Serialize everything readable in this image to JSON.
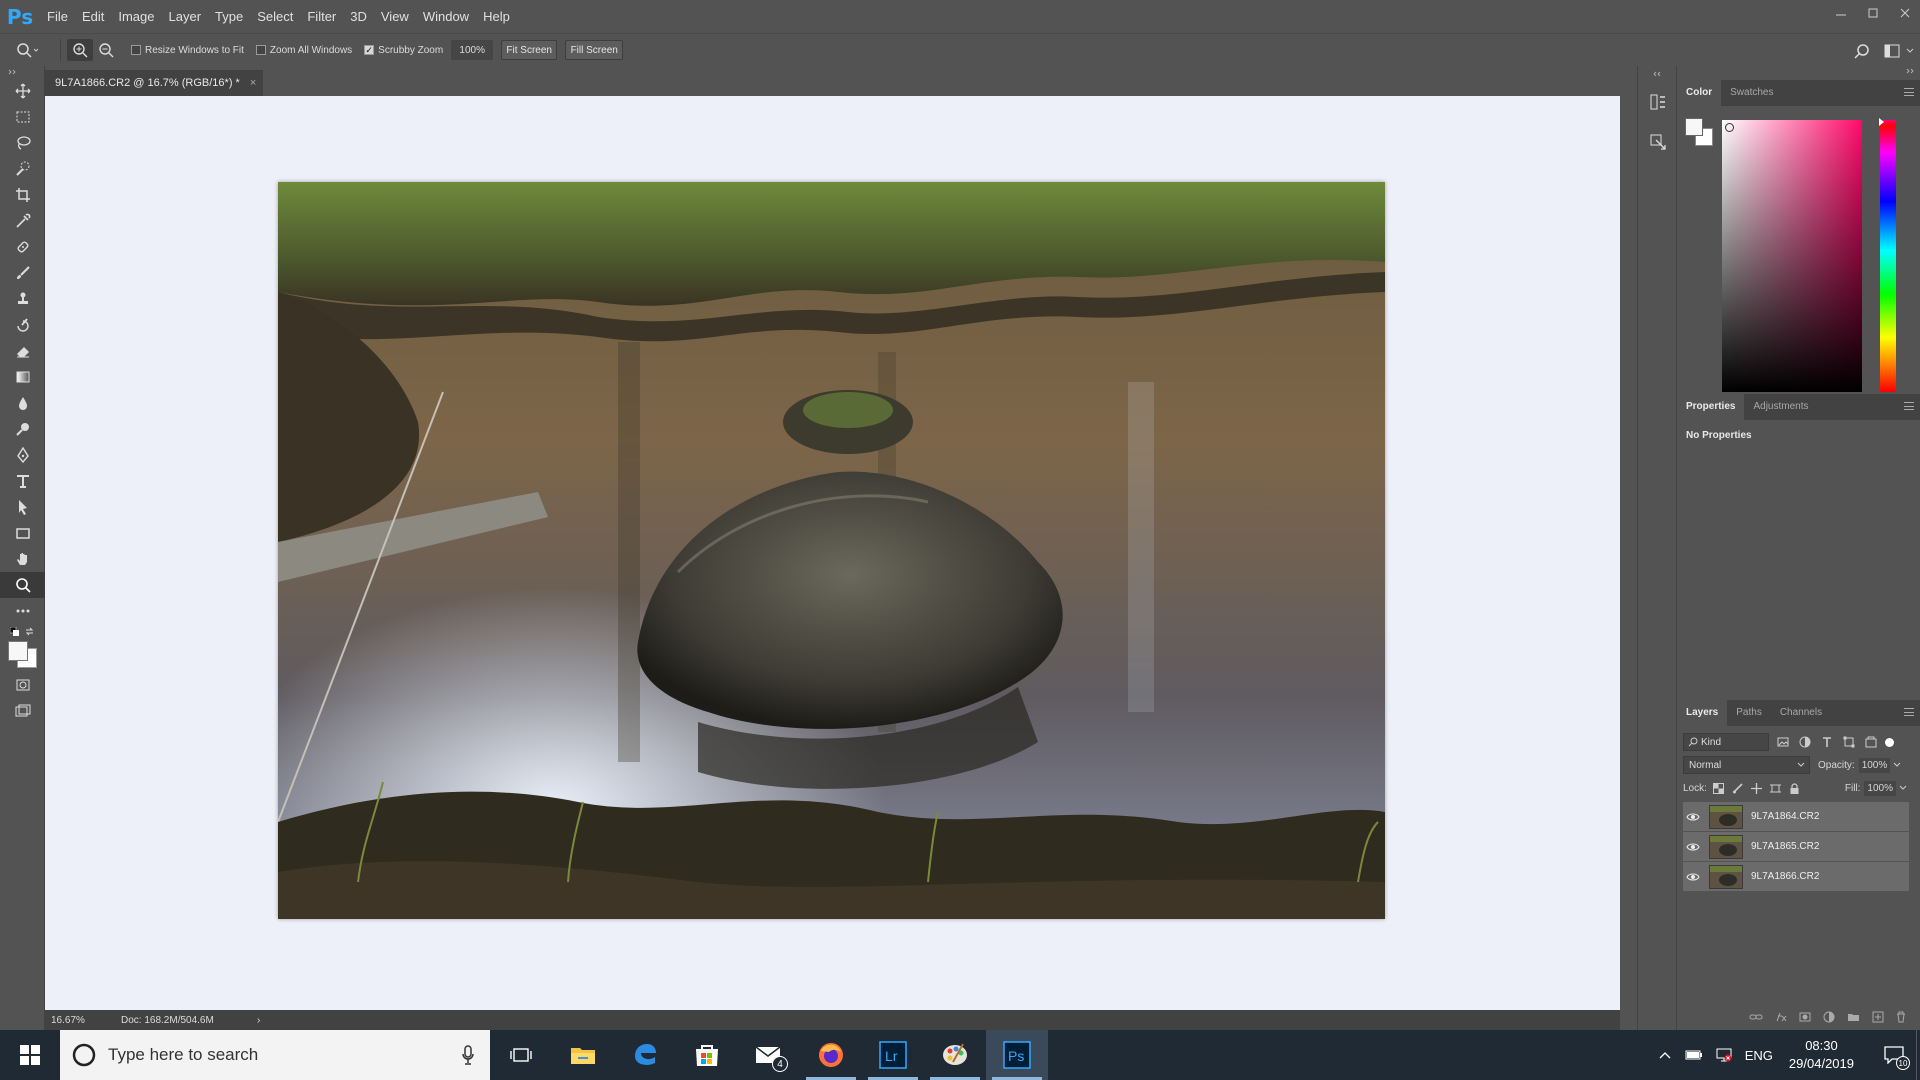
{
  "app": {
    "logo": "Ps"
  },
  "menu": [
    "File",
    "Edit",
    "Image",
    "Layer",
    "Type",
    "Select",
    "Filter",
    "3D",
    "View",
    "Window",
    "Help"
  ],
  "options": {
    "resize_windows": "Resize Windows to Fit",
    "zoom_all": "Zoom All Windows",
    "scrubby_zoom": "Scrubby Zoom",
    "zoom_value": "100%",
    "fit_screen": "Fit Screen",
    "fill_screen": "Fill Screen"
  },
  "document": {
    "tab_title": "9L7A1866.CR2 @ 16.7% (RGB/16*) *",
    "close": "×"
  },
  "status": {
    "zoom": "16.67%",
    "doc": "Doc: 168.2M/504.6M",
    "arrow": "›"
  },
  "color_panel": {
    "tabs": [
      "Color",
      "Swatches"
    ]
  },
  "properties_panel": {
    "tabs": [
      "Properties",
      "Adjustments"
    ],
    "message": "No Properties"
  },
  "layers_panel": {
    "tabs": [
      "Layers",
      "Paths",
      "Channels"
    ],
    "filter": "Kind",
    "blend_mode": "Normal",
    "opacity_label": "Opacity:",
    "opacity": "100%",
    "lock_label": "Lock:",
    "fill_label": "Fill:",
    "fill": "100%",
    "layers": [
      {
        "name": "9L7A1864.CR2"
      },
      {
        "name": "9L7A1865.CR2"
      },
      {
        "name": "9L7A1866.CR2"
      }
    ]
  },
  "taskbar": {
    "search_placeholder": "Type here to search",
    "mail_badge": "4",
    "lang": "ENG",
    "time": "08:30",
    "date": "29/04/2019",
    "notif_count": "10",
    "apps": [
      "task-view",
      "file-explorer",
      "edge",
      "store",
      "mail",
      "firefox",
      "lightroom",
      "paint",
      "photoshop"
    ]
  },
  "colors": {
    "accent": "#31a8ff",
    "panel": "#535353",
    "dark": "#424242",
    "canvas": "#eef0f9",
    "taskbar": "#1f2a35"
  }
}
